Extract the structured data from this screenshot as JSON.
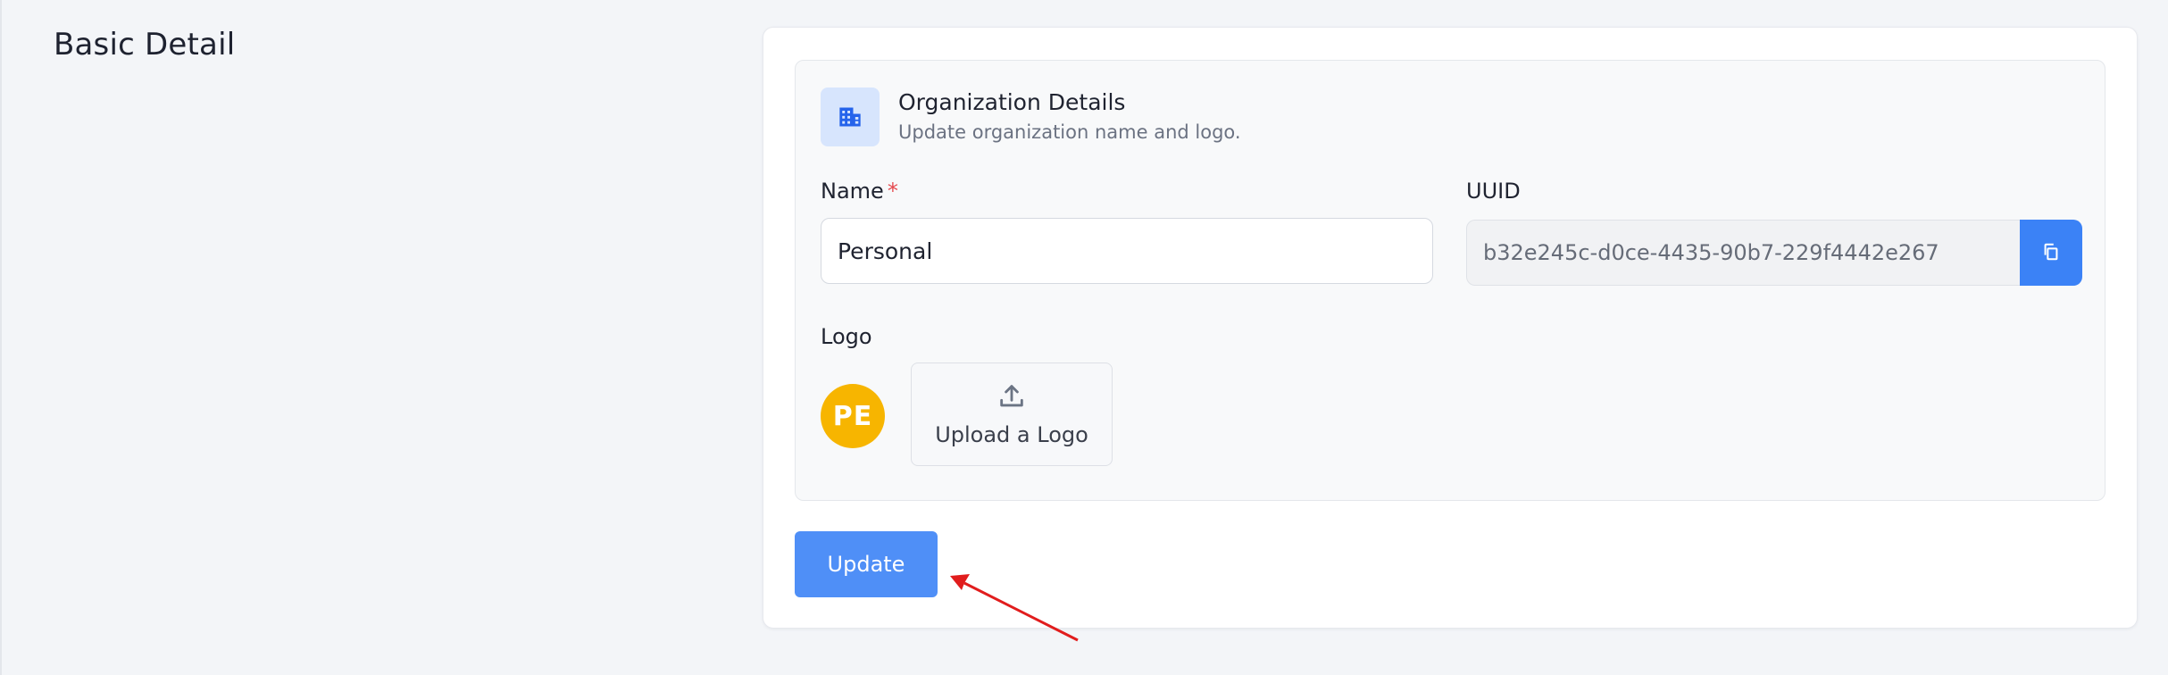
{
  "section": {
    "title": "Basic Detail"
  },
  "organization": {
    "header_icon": "building-icon",
    "title": "Organization Details",
    "subtitle": "Update organization name and logo."
  },
  "name_field": {
    "label": "Name",
    "required_mark": "*",
    "value": "Personal"
  },
  "uuid_field": {
    "label": "UUID",
    "value": "b32e245c-d0ce-4435-90b7-229f4442e267",
    "copy_icon": "copy-icon"
  },
  "logo": {
    "label": "Logo",
    "avatar_initials": "PE",
    "avatar_color": "#f7b500",
    "upload_icon": "upload-icon",
    "upload_label": "Upload a Logo"
  },
  "actions": {
    "update_label": "Update"
  },
  "colors": {
    "accent": "#4f8ff7",
    "annotation": "#e11d1d"
  }
}
